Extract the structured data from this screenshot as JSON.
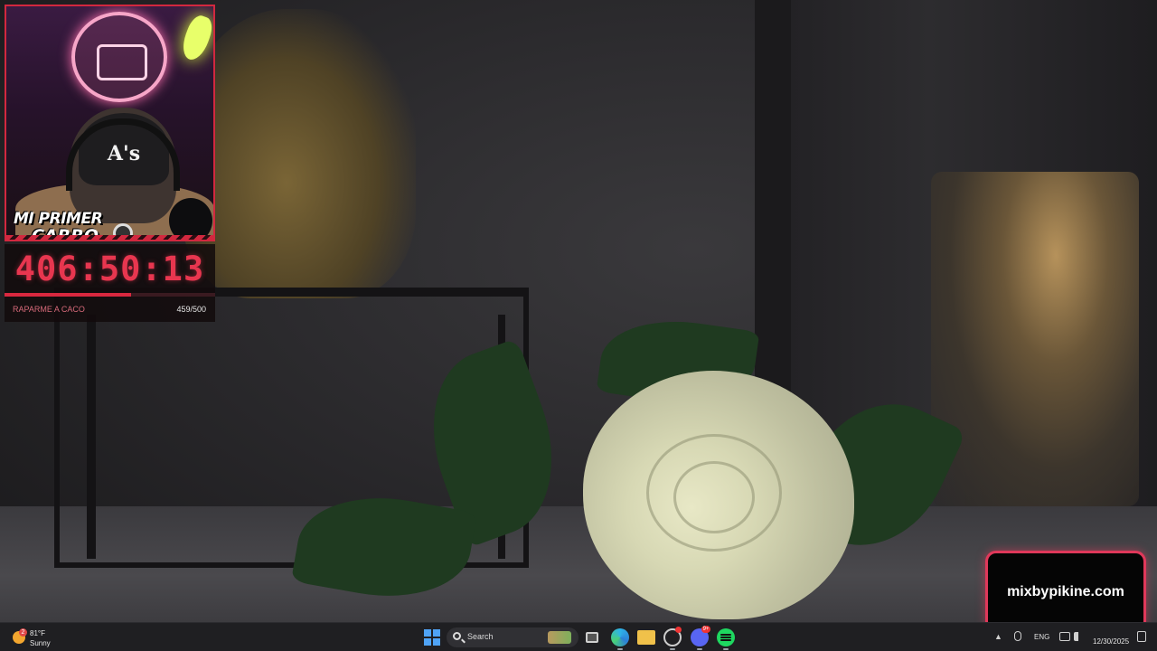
{
  "overlay": {
    "webcam_logo_text_line1": "MI PRIMER",
    "webcam_logo_text_line2": "CARRO",
    "cap_logo": "A's",
    "timer": "406:50:13",
    "goal": {
      "label": "RAPARME A CACO",
      "count": "459/500",
      "progress": 0.6
    },
    "promo_text": "mixbypikine.com",
    "accent_color": "#d2283f"
  },
  "taskbar": {
    "weather": {
      "temperature": "81°F",
      "condition": "Sunny",
      "badge": "2",
      "icon": "sun-icon"
    },
    "search": {
      "label": "Search"
    },
    "pinned_apps": [
      "start-icon",
      "taskview-icon",
      "edge-icon",
      "folder-icon",
      "chat-icon",
      "discord-icon",
      "spotify-icon"
    ],
    "discord_badge": "9+",
    "tray": {
      "language": "ENG",
      "time": "",
      "date": "12/30/2025"
    }
  }
}
